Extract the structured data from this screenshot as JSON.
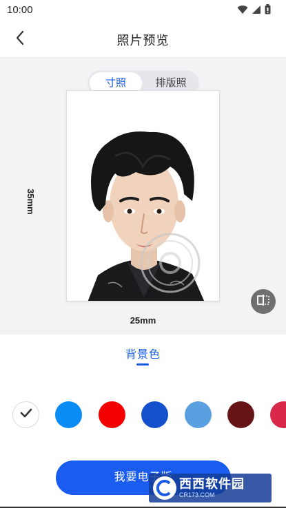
{
  "status_bar": {
    "time": "10:00",
    "icons": [
      "wifi-icon",
      "signal-icon",
      "battery-icon"
    ]
  },
  "nav": {
    "back_icon": "chevron-left-icon",
    "title": "照片预览"
  },
  "preview": {
    "tabs": [
      {
        "label": "寸照",
        "active": true
      },
      {
        "label": "排版照",
        "active": false
      }
    ],
    "height_label": "35mm",
    "width_label": "25mm",
    "compare_icon": "compare-split-icon",
    "photo": "portrait-photo"
  },
  "background": {
    "section_label": "背景色",
    "swatches": [
      {
        "name": "white",
        "color": "#ffffff",
        "selected": true
      },
      {
        "name": "blue",
        "color": "#0a8cf5",
        "selected": false
      },
      {
        "name": "red",
        "color": "#f50000",
        "selected": false
      },
      {
        "name": "dark-blue",
        "color": "#1550cc",
        "selected": false
      },
      {
        "name": "light-blue",
        "color": "#5a9fe0",
        "selected": false
      },
      {
        "name": "maroon",
        "color": "#661516",
        "selected": false
      },
      {
        "name": "crimson",
        "color": "#d8294a",
        "selected": false
      }
    ]
  },
  "action": {
    "primary_label": "我要电子版"
  },
  "watermark": {
    "main_text": "西西软件园",
    "sub_text": "CR173.COM"
  },
  "colors": {
    "accent": "#1a5ce6",
    "button": "#1a5cf0",
    "preview_bg": "#f2f3f5"
  }
}
